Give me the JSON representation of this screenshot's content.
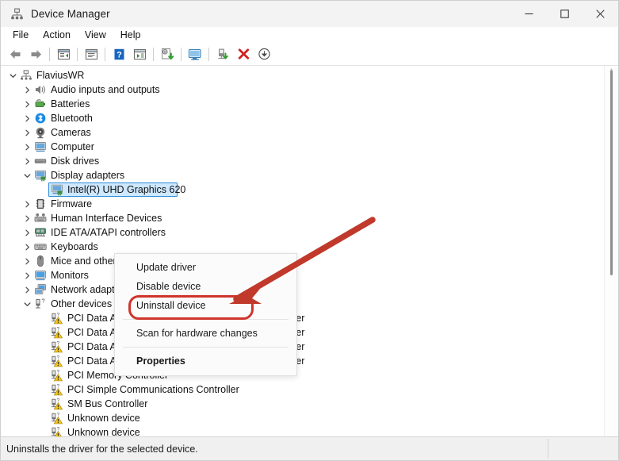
{
  "window": {
    "title": "Device Manager",
    "app_icon": "device-manager-icon",
    "controls": {
      "minimize": "minimize-icon",
      "maximize": "maximize-icon",
      "close": "close-icon"
    }
  },
  "menubar": {
    "items": [
      {
        "label": "File"
      },
      {
        "label": "Action"
      },
      {
        "label": "View"
      },
      {
        "label": "Help"
      }
    ]
  },
  "toolbar": {
    "buttons": [
      {
        "name": "back-icon"
      },
      {
        "name": "forward-icon"
      },
      {
        "name": "show-hide-console-tree-icon"
      },
      {
        "name": "properties-icon"
      },
      {
        "name": "help-icon"
      },
      {
        "name": "view-icon"
      },
      {
        "name": "update-driver-icon"
      },
      {
        "name": "scan-hardware-changes-icon"
      },
      {
        "name": "enable-device-icon"
      },
      {
        "name": "uninstall-device-icon"
      },
      {
        "name": "disable-device-icon"
      }
    ]
  },
  "tree": {
    "root": {
      "label": "FlaviusWR",
      "icon": "computer-root-icon",
      "expanded": true
    },
    "items": [
      {
        "label": "Audio inputs and outputs",
        "icon": "speaker-icon",
        "expanded": false,
        "level": 1
      },
      {
        "label": "Batteries",
        "icon": "battery-icon",
        "expanded": false,
        "level": 1
      },
      {
        "label": "Bluetooth",
        "icon": "bluetooth-icon",
        "expanded": false,
        "level": 1
      },
      {
        "label": "Cameras",
        "icon": "camera-icon",
        "expanded": false,
        "level": 1
      },
      {
        "label": "Computer",
        "icon": "monitor-icon",
        "expanded": false,
        "level": 1
      },
      {
        "label": "Disk drives",
        "icon": "disk-drive-icon",
        "expanded": false,
        "level": 1
      },
      {
        "label": "Display adapters",
        "icon": "display-adapter-icon",
        "expanded": true,
        "level": 1
      },
      {
        "label": "Intel(R) UHD Graphics 620",
        "icon": "display-adapter-icon",
        "selected": true,
        "level": 2
      },
      {
        "label": "Firmware",
        "icon": "firmware-icon",
        "expanded": false,
        "level": 1
      },
      {
        "label": "Human Interface Devices",
        "icon": "hid-icon",
        "expanded": false,
        "level": 1
      },
      {
        "label": "IDE ATA/ATAPI controllers",
        "icon": "ide-controller-icon",
        "expanded": false,
        "level": 1
      },
      {
        "label": "Keyboards",
        "icon": "keyboard-icon",
        "expanded": false,
        "level": 1
      },
      {
        "label": "Mice and other pointing devices",
        "icon": "mouse-icon",
        "expanded": false,
        "level": 1
      },
      {
        "label": "Monitors",
        "icon": "monitor-icon",
        "expanded": false,
        "level": 1
      },
      {
        "label": "Network adapters",
        "icon": "network-adapter-icon",
        "expanded": false,
        "level": 1
      },
      {
        "label": "Other devices",
        "icon": "other-device-icon",
        "expanded": true,
        "level": 1
      },
      {
        "label": "PCI Data Acquisition and Signal Processing Controller",
        "icon": "unknown-device-warning-icon",
        "level": 2
      },
      {
        "label": "PCI Data Acquisition and Signal Processing Controller",
        "icon": "unknown-device-warning-icon",
        "level": 2
      },
      {
        "label": "PCI Data Acquisition and Signal Processing Controller",
        "icon": "unknown-device-warning-icon",
        "level": 2
      },
      {
        "label": "PCI Data Acquisition and Signal Processing Controller",
        "icon": "unknown-device-warning-icon",
        "level": 2
      },
      {
        "label": "PCI Memory Controller",
        "icon": "unknown-device-warning-icon",
        "level": 2
      },
      {
        "label": "PCI Simple Communications Controller",
        "icon": "unknown-device-warning-icon",
        "level": 2
      },
      {
        "label": "SM Bus Controller",
        "icon": "unknown-device-warning-icon",
        "level": 2
      },
      {
        "label": "Unknown device",
        "icon": "unknown-device-warning-icon",
        "level": 2
      },
      {
        "label": "Unknown device",
        "icon": "unknown-device-warning-icon",
        "level": 2
      }
    ]
  },
  "context_menu": {
    "items": [
      {
        "label": "Update driver",
        "bold": false
      },
      {
        "label": "Disable device",
        "bold": false
      },
      {
        "label": "Uninstall device",
        "bold": false,
        "highlighted": true
      },
      {
        "separator": true
      },
      {
        "label": "Scan for hardware changes",
        "bold": false
      },
      {
        "separator": true
      },
      {
        "label": "Properties",
        "bold": true
      }
    ]
  },
  "annotation": {
    "highlight_color": "#d0342c",
    "arrow_color": "#c0392b",
    "target": "Uninstall device"
  },
  "statusbar": {
    "text": "Uninstalls the driver for the selected device."
  }
}
